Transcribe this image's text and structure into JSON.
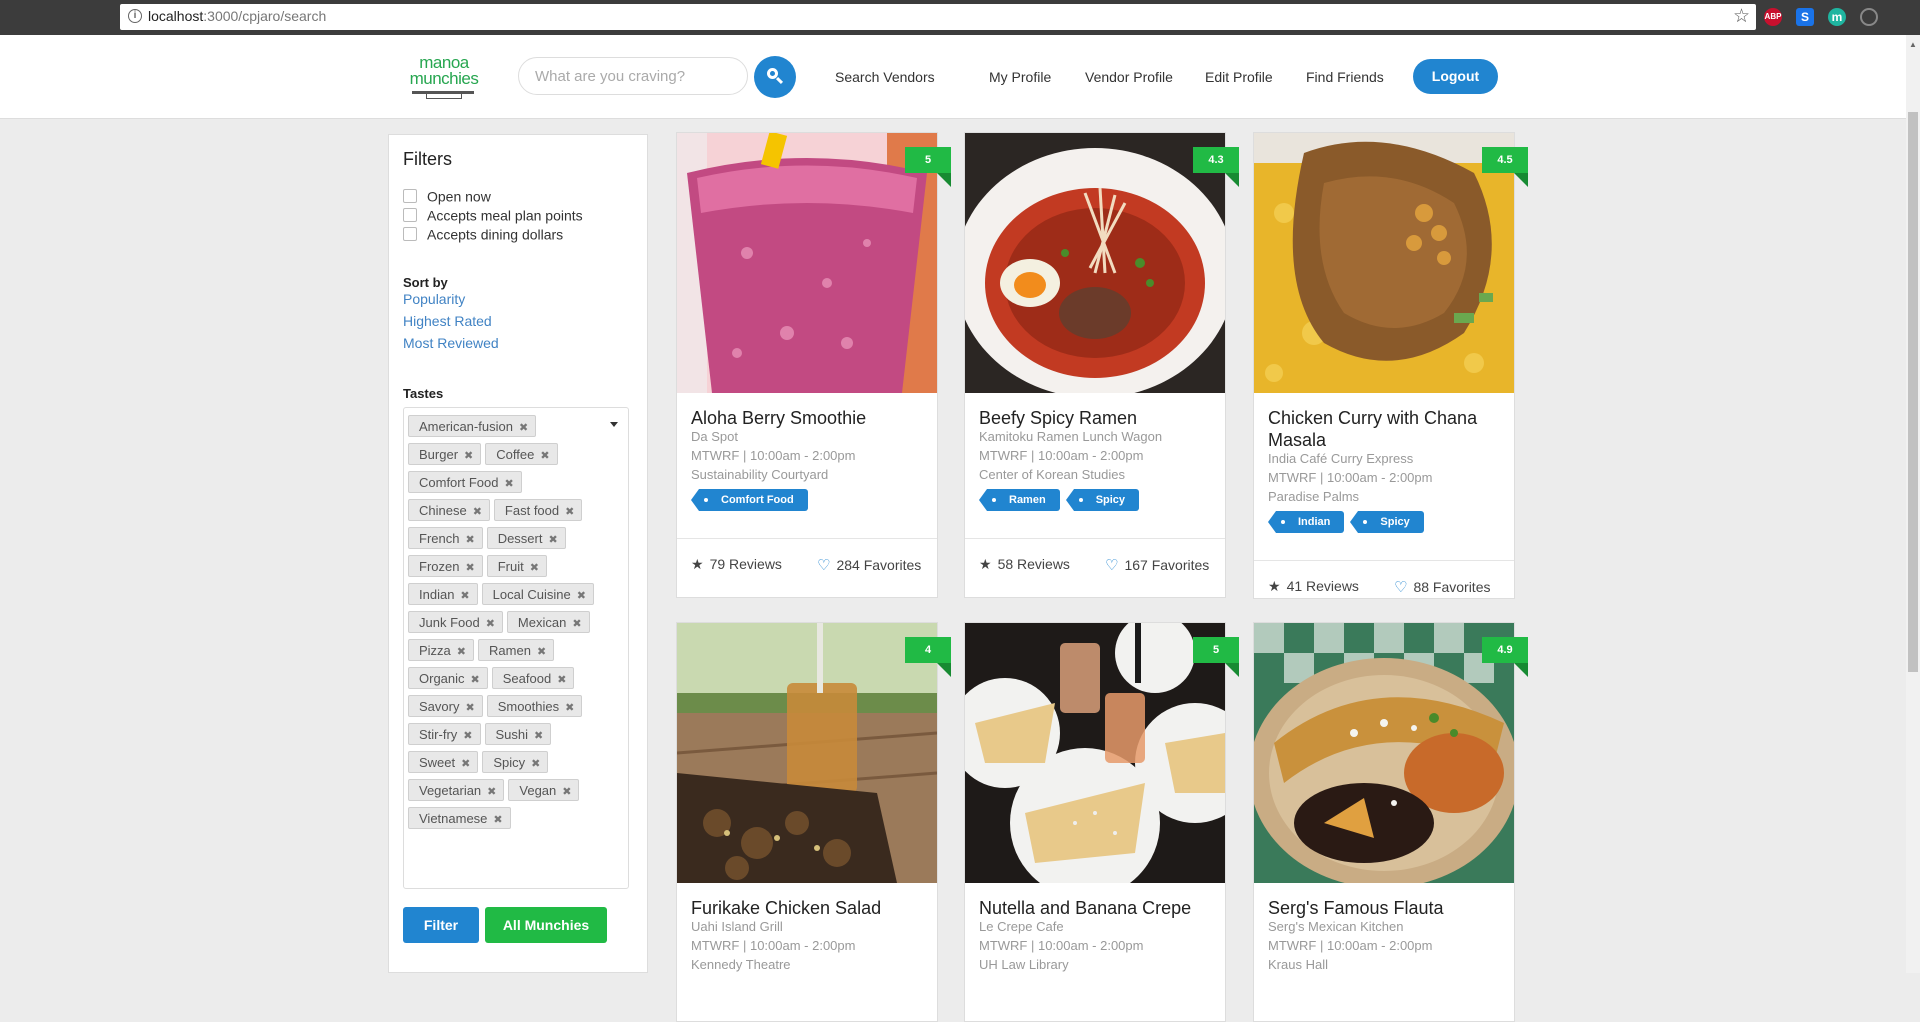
{
  "browser": {
    "url_host": "localhost",
    "url_path": ":3000/cpjaro/search",
    "extensions": [
      "ABP",
      "S",
      "m",
      ""
    ]
  },
  "nav": {
    "logo_line1": "manoa",
    "logo_line2": "munchies",
    "search_placeholder": "What are you craving?",
    "links": [
      "Search Vendors",
      "My Profile",
      "Vendor Profile",
      "Edit Profile",
      "Find Friends"
    ],
    "logout": "Logout"
  },
  "filters": {
    "title": "Filters",
    "checkboxes": [
      "Open now",
      "Accepts meal plan points",
      "Accepts dining dollars"
    ],
    "sort_label": "Sort by",
    "sort_options": [
      "Popularity",
      "Highest Rated",
      "Most Reviewed"
    ],
    "tastes_label": "Tastes",
    "tastes": [
      "American-fusion",
      "Burger",
      "Coffee",
      "Comfort Food",
      "Chinese",
      "Fast food",
      "French",
      "Dessert",
      "Frozen",
      "Fruit",
      "Indian",
      "Local Cuisine",
      "Junk Food",
      "Mexican",
      "Pizza",
      "Ramen",
      "Organic",
      "Seafood",
      "Savory",
      "Smoothies",
      "Stir-fry",
      "Sushi",
      "Sweet",
      "Spicy",
      "Vegetarian",
      "Vegan",
      "Vietnamese"
    ],
    "filter_button": "Filter",
    "all_button": "All Munchies"
  },
  "cards": [
    {
      "name": "Aloha Berry Smoothie",
      "vendor": "Da Spot",
      "hours": "MTWRF | 10:00am - 2:00pm",
      "location": "Sustainability Courtyard",
      "rating": "5",
      "tags": [
        "Comfort Food"
      ],
      "reviews": "79 Reviews",
      "favorites": "284 Favorites",
      "image": "smoothie"
    },
    {
      "name": "Beefy Spicy Ramen",
      "vendor": "Kamitoku Ramen Lunch Wagon",
      "hours": "MTWRF | 10:00am - 2:00pm",
      "location": "Center of Korean Studies",
      "rating": "4.3",
      "tags": [
        "Ramen",
        "Spicy"
      ],
      "reviews": "58 Reviews",
      "favorites": "167 Favorites",
      "image": "ramen"
    },
    {
      "name": "Chicken Curry with Chana Masala",
      "vendor": "India Café Curry Express",
      "hours": "MTWRF | 10:00am - 2:00pm",
      "location": "Paradise Palms",
      "rating": "4.5",
      "tags": [
        "Indian",
        "Spicy"
      ],
      "reviews": "41 Reviews",
      "favorites": "88 Favorites",
      "image": "curry"
    },
    {
      "name": "Furikake Chicken Salad",
      "vendor": "Uahi Island Grill",
      "hours": "MTWRF | 10:00am - 2:00pm",
      "location": "Kennedy Theatre",
      "rating": "4",
      "tags": [],
      "reviews": "",
      "favorites": "",
      "image": "salad"
    },
    {
      "name": "Nutella and Banana Crepe",
      "vendor": "Le Crepe Cafe",
      "hours": "MTWRF | 10:00am - 2:00pm",
      "location": "UH Law Library",
      "rating": "5",
      "tags": [],
      "reviews": "",
      "favorites": "",
      "image": "crepe"
    },
    {
      "name": "Serg's Famous Flauta",
      "vendor": "Serg's Mexican Kitchen",
      "hours": "MTWRF | 10:00am - 2:00pm",
      "location": "Kraus Hall",
      "rating": "4.9",
      "tags": [],
      "reviews": "",
      "favorites": "",
      "image": "flauta"
    }
  ]
}
